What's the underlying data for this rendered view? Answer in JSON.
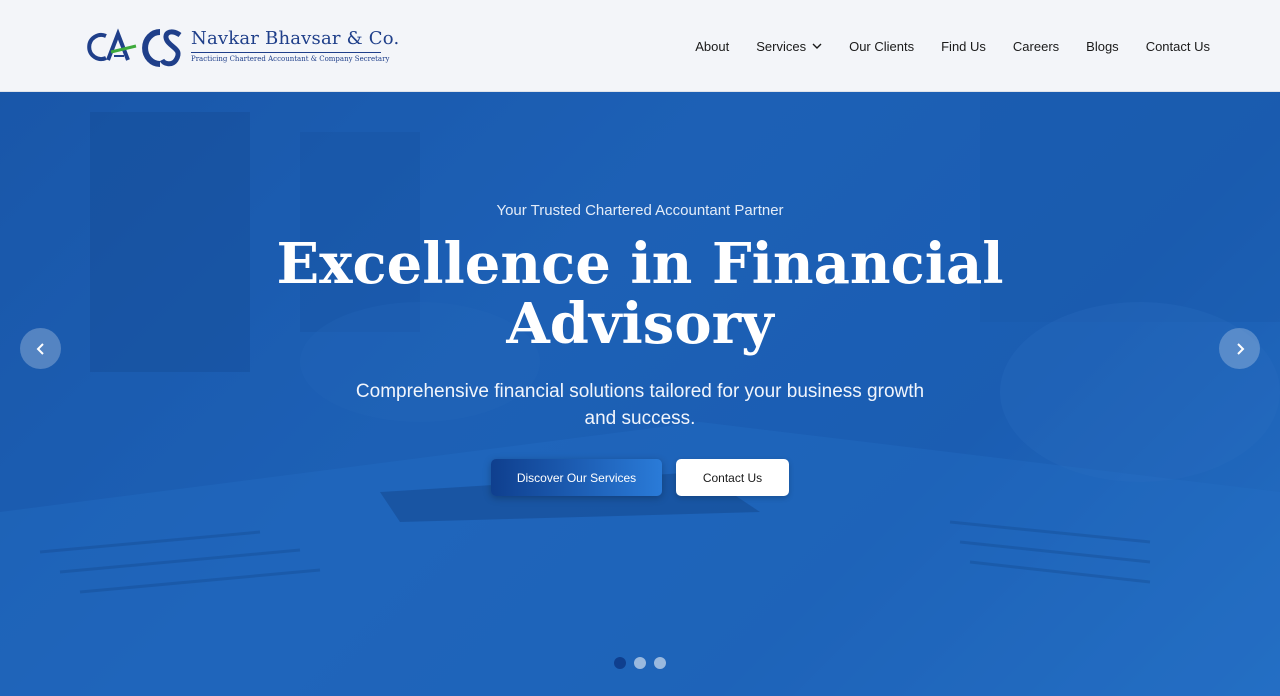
{
  "brand": {
    "logo_letters": "CA CS",
    "name": "Navkar Bhavsar & Co.",
    "tagline": "Practicing Chartered Accountant & Company Secretary",
    "colors": {
      "navy": "#1f3f8a",
      "green": "#3daa3c"
    }
  },
  "nav": {
    "items": [
      {
        "label": "About"
      },
      {
        "label": "Services",
        "has_dropdown": true
      },
      {
        "label": "Our Clients"
      },
      {
        "label": "Find Us"
      },
      {
        "label": "Careers"
      },
      {
        "label": "Blogs"
      },
      {
        "label": "Contact Us"
      }
    ]
  },
  "hero": {
    "eyebrow": "Your Trusted Chartered Accountant Partner",
    "headline": "Excellence in Financial Advisory",
    "subhead": "Comprehensive financial solutions tailored for your business growth and success.",
    "primary_cta": "Discover Our Services",
    "secondary_cta": "Contact Us",
    "prev_icon": "chevron-left-icon",
    "next_icon": "chevron-right-icon",
    "slides": {
      "count": 3,
      "active": 1
    },
    "overlay_color": "#1c60b6"
  }
}
